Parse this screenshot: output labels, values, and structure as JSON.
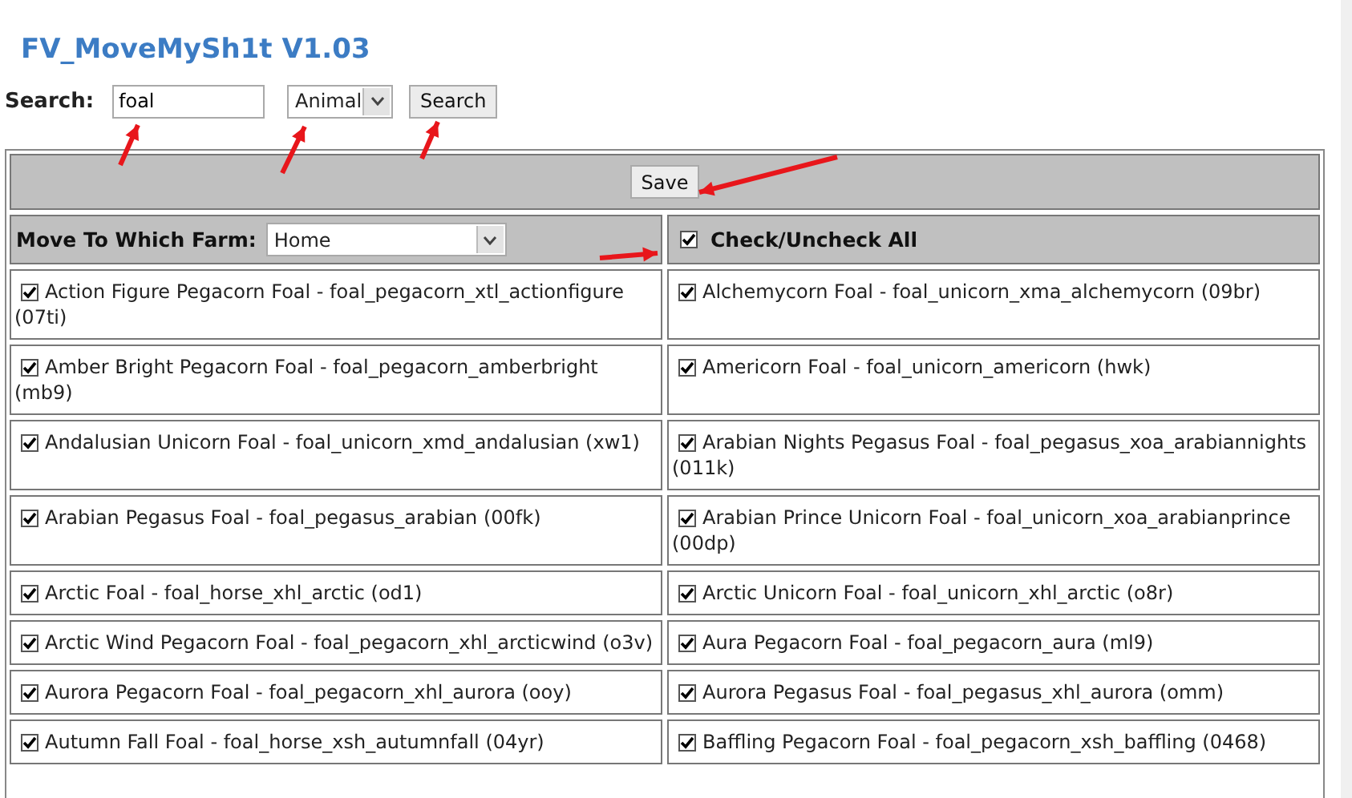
{
  "title": "FV_MoveMySh1t V1.03",
  "search": {
    "label": "Search:",
    "value": "foal",
    "type_select": "Animal",
    "button": "Search"
  },
  "save_button": "Save",
  "farm": {
    "label": "Move To Which Farm:",
    "value": "Home"
  },
  "check_all": {
    "label": "Check/Uncheck All",
    "checked": true
  },
  "animals": [
    {
      "label": "Action Figure Pegacorn Foal - foal_pegacorn_xtl_actionfigure (07ti)",
      "checked": true
    },
    {
      "label": "Alchemycorn Foal - foal_unicorn_xma_alchemycorn (09br)",
      "checked": true
    },
    {
      "label": "Amber Bright Pegacorn Foal - foal_pegacorn_amberbright (mb9)",
      "checked": true
    },
    {
      "label": "Americorn Foal - foal_unicorn_americorn (hwk)",
      "checked": true
    },
    {
      "label": "Andalusian Unicorn Foal - foal_unicorn_xmd_andalusian (xw1)",
      "checked": true
    },
    {
      "label": "Arabian Nights Pegasus Foal - foal_pegasus_xoa_arabiannights (011k)",
      "checked": true
    },
    {
      "label": "Arabian Pegasus Foal - foal_pegasus_arabian (00fk)",
      "checked": true
    },
    {
      "label": "Arabian Prince Unicorn Foal - foal_unicorn_xoa_arabianprince (00dp)",
      "checked": true
    },
    {
      "label": "Arctic Foal - foal_horse_xhl_arctic (od1)",
      "checked": true
    },
    {
      "label": "Arctic Unicorn Foal - foal_unicorn_xhl_arctic (o8r)",
      "checked": true
    },
    {
      "label": "Arctic Wind Pegacorn Foal - foal_pegacorn_xhl_arcticwind (o3v)",
      "checked": true
    },
    {
      "label": "Aura Pegacorn Foal - foal_pegacorn_aura (ml9)",
      "checked": true
    },
    {
      "label": "Aurora Pegacorn Foal - foal_pegacorn_xhl_aurora (ooy)",
      "checked": true
    },
    {
      "label": "Aurora Pegasus Foal - foal_pegasus_xhl_aurora (omm)",
      "checked": true
    },
    {
      "label": "Autumn Fall Foal - foal_horse_xsh_autumnfall (04yr)",
      "checked": true
    },
    {
      "label": "Baffling Pegacorn Foal - foal_pegacorn_xsh_baffling (0468)",
      "checked": true
    }
  ]
}
